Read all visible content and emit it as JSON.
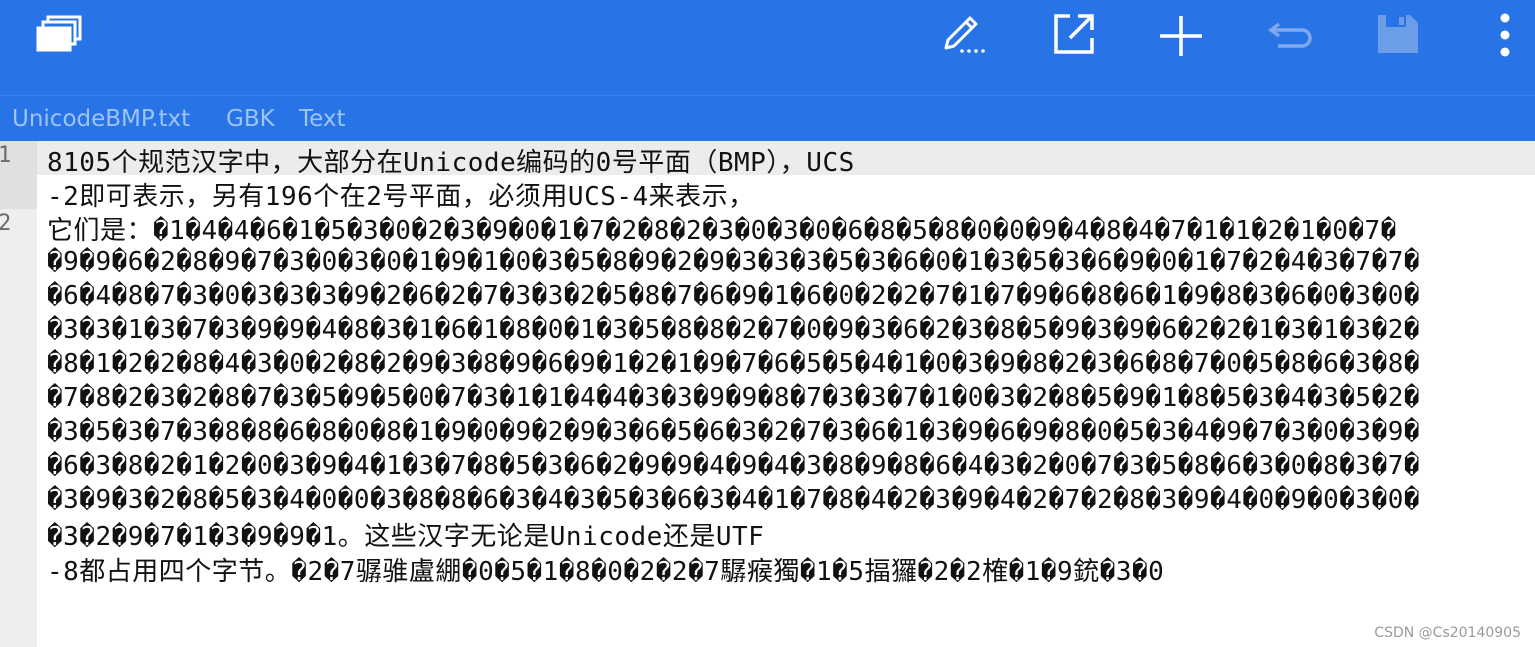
{
  "toolbar": {
    "icons": [
      "windows-icon",
      "edit-icon",
      "open-external-icon",
      "add-icon",
      "undo-icon",
      "save-icon",
      "more-vert-icon"
    ],
    "accent": "#2874e6"
  },
  "tabs": [
    {
      "label": "UnicodeBMP.txt"
    },
    {
      "label": "GBK"
    },
    {
      "label": "Text"
    }
  ],
  "gutter": {
    "line_numbers": [
      "1",
      "2"
    ]
  },
  "editor": {
    "lines": [
      "8105个规范汉字中，大部分在Unicode编码的0号平面（BMP），UCS",
      "-2即可表示，另有196个在2号平面，必须用UCS-4来表示，",
      "它们是：�1�4�4�6�1�5�3�0�2�3�9�0�1�7�2�8�2�3�0�3�0�6�8�5�8�0�0�9�4�8�4�7�1�1�2�1�0�7�",
      "�9�9�6�2�8�9�7�3�0�3�0�1�9�1�0�3�5�8�9�2�9�3�3�3�5�3�6�0�1�3�5�3�6�9�0�1�7�2�4�3�7�7�",
      "�6�4�8�7�3�0�3�3�3�9�2�6�2�7�3�3�2�5�8�7�6�9�1�6�0�2�2�7�1�7�9�6�8�6�1�9�8�3�6�0�3�0�",
      "�3�3�1�3�7�3�9�9�4�8�3�1�6�1�8�0�1�3�5�8�8�2�7�0�9�3�6�2�3�8�5�9�3�9�6�2�2�1�3�1�3�2�",
      "�8�1�2�2�8�4�3�0�2�8�2�9�3�8�9�6�9�1�2�1�9�7�6�5�5�4�1�0�3�9�8�2�3�6�8�7�0�5�8�6�3�8�",
      "�7�8�2�3�2�8�7�3�5�9�5�0�7�3�1�1�4�4�3�3�9�9�8�7�3�3�7�1�0�3�2�8�5�9�1�8�5�3�4�3�5�2�",
      "�3�5�3�7�3�8�8�6�8�0�8�1�9�0�9�2�9�3�6�5�6�3�2�7�3�6�1�3�9�6�9�8�0�5�3�4�9�7�3�0�3�9�",
      "�6�3�8�2�1�2�0�3�9�4�1�3�7�8�5�3�6�2�9�9�4�9�4�3�8�9�8�6�4�3�2�0�7�3�5�8�6�3�0�8�3�7�",
      "�3�9�3�2�8�5�3�4�0�0�3�8�8�6�3�4�3�5�3�6�3�4�1�7�8�4�2�3�9�4�2�7�2�8�3�9�4�0�9�0�3�0�",
      "�3�2�9�7�1�3�9�9�1。这些汉字无论是Unicode还是UTF",
      "-8都占用四个字节。�2�7骣骓盧綳�0�5�1�8�0�2�2�7驏瘊獨�1�5揊玀�2�2榷�1�9銃�3�0"
    ]
  },
  "watermark": "CSDN @Cs20140905"
}
